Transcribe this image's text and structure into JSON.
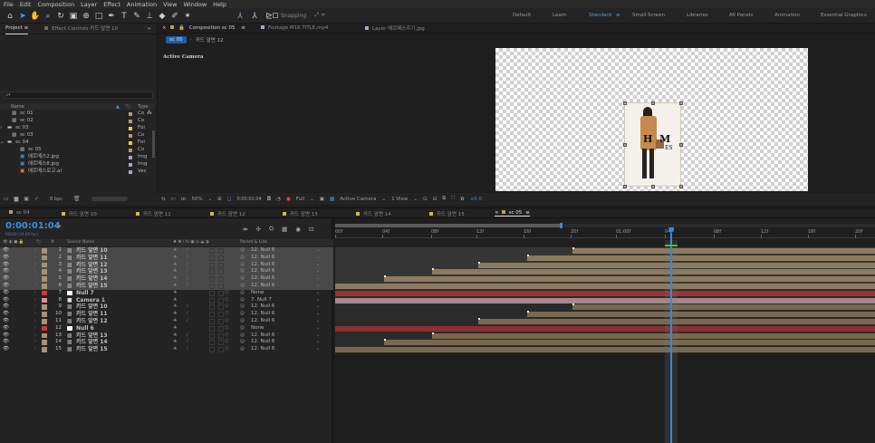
{
  "menu": [
    "File",
    "Edit",
    "Composition",
    "Layer",
    "Effect",
    "Animation",
    "View",
    "Window",
    "Help"
  ],
  "toolbar": {
    "snapping": "Snapping",
    "workspaces": [
      "Default",
      "Learn",
      "Standard",
      "Small Screen",
      "Libraries",
      "All Panels",
      "Animation",
      "Essential Graphics"
    ],
    "active_workspace": "Standard",
    "workspace_menu": "≡"
  },
  "project_panel": {
    "tabs": [
      "Project",
      "Effect Controls 카드 앞면 10"
    ],
    "menu": "≡",
    "expand": "»",
    "search_placeholder": "ρ▾",
    "col_name": "Name",
    "col_type": "Type",
    "items": [
      {
        "name": "sc 01",
        "type": "Co",
        "color": "#b59c6e",
        "kind": "comp"
      },
      {
        "name": "sc 02",
        "type": "Co",
        "color": "#b59c6e",
        "kind": "comp"
      },
      {
        "name": "sc 03",
        "type": "Fol",
        "color": "#e6cd45",
        "kind": "folder"
      },
      {
        "name": "sc 03",
        "type": "Co",
        "color": "#b59c6e",
        "kind": "comp"
      },
      {
        "name": "sc 04",
        "type": "Fol",
        "color": "#e6cd45",
        "kind": "folder"
      },
      {
        "name": "sc 05",
        "type": "Co",
        "color": "#b59c6e",
        "kind": "comp"
      },
      {
        "name": "에르메스2.jpg",
        "type": "Img",
        "color": "#a8a4ce",
        "kind": "img"
      },
      {
        "name": "에르메스8.jpg",
        "type": "Img",
        "color": "#a8a4ce",
        "kind": "img"
      },
      {
        "name": "에르메스로고.ai",
        "type": "Vec",
        "color": "#a8a4ce",
        "kind": "ai"
      }
    ],
    "footer": "8 bpc"
  },
  "comp_panel": {
    "tabs": [
      "Composition sc 05",
      "Footage M16 TITLE.mp4",
      "Layer 에르메스주기.jpg"
    ],
    "menu": "≡",
    "breadcrumb": [
      "sc 05",
      "카드 앞면 12"
    ],
    "view_label": "Active Camera",
    "logo_text": "H  M",
    "logo_sub": "ES"
  },
  "viewer_bar": {
    "zoom": "50%",
    "timecode": "0:00:01:04",
    "resolution": "Full",
    "camera": "Active Camera",
    "views": "1 View",
    "exposure": "+0.0"
  },
  "timeline": {
    "tabs": [
      "sc 04",
      "카드 앞면 10",
      "카드 앞면 11",
      "카드 앞면 12",
      "카드 앞면 13",
      "카드 앞면 14",
      "카드 앞면 15",
      "sc 05"
    ],
    "active_tab": "sc 05",
    "menu": "≡",
    "timecode": "0:00:01:04",
    "fps": "00028 (24.00 fps)",
    "search_placeholder": "ρ▾",
    "col_source": "Source Name",
    "col_parent": "Parent & Link",
    "switches_header": "♣ ✱ \\ fx ▣ ◎ ◒ ◑",
    "ruler": [
      "00f",
      "04f",
      "08f",
      "12f",
      "16f",
      "20f",
      "01:00f",
      "04f",
      "08f",
      "12f",
      "16f",
      "20f"
    ],
    "current_time_fraction": 0.623,
    "layers": [
      {
        "num": "1",
        "name": "카드 앞면 10",
        "label": "#a89274",
        "type": "comp",
        "parent": "12. Null 6",
        "sel": true,
        "start": 0.44,
        "end": 1.0,
        "color": "#8c7a5e"
      },
      {
        "num": "2",
        "name": "카드 앞면 11",
        "label": "#a89274",
        "type": "comp",
        "parent": "12. Null 6",
        "sel": true,
        "start": 0.355,
        "end": 1.0,
        "color": "#8c7a5e"
      },
      {
        "num": "3",
        "name": "카드 앞면 12",
        "label": "#a89274",
        "type": "comp",
        "parent": "12. Null 6",
        "sel": true,
        "start": 0.265,
        "end": 1.0,
        "color": "#8c7a5e"
      },
      {
        "num": "4",
        "name": "카드 앞면 13",
        "label": "#a89274",
        "type": "comp",
        "parent": "12. Null 6",
        "sel": true,
        "start": 0.18,
        "end": 1.0,
        "color": "#8c7a5e"
      },
      {
        "num": "5",
        "name": "카드 앞면 14",
        "label": "#a89274",
        "type": "comp",
        "parent": "12. Null 6",
        "sel": true,
        "start": 0.09,
        "end": 1.0,
        "color": "#8c7a5e"
      },
      {
        "num": "6",
        "name": "카드 앞면 15",
        "label": "#a89274",
        "type": "comp",
        "parent": "12. Null 6",
        "sel": true,
        "start": 0.0,
        "end": 1.0,
        "color": "#8c7a5e"
      },
      {
        "num": "7",
        "name": "Null 7",
        "label": "#c83a3a",
        "type": "null",
        "parent": "None",
        "sel": false,
        "start": 0.0,
        "end": 1.0,
        "color": "#9a3434"
      },
      {
        "num": "8",
        "name": "Camera 1",
        "label": "#d98f9a",
        "type": "camera",
        "parent": "7. Null 7",
        "sel": false,
        "start": 0.0,
        "end": 1.0,
        "color": "#a88890"
      },
      {
        "num": "9",
        "name": "카드 앞면 10",
        "label": "#a89274",
        "type": "comp",
        "parent": "12. Null 6",
        "sel": false,
        "start": 0.44,
        "end": 1.0,
        "color": "#77684f"
      },
      {
        "num": "10",
        "name": "카드 앞면 11",
        "label": "#a89274",
        "type": "comp",
        "parent": "12. Null 6",
        "sel": false,
        "start": 0.355,
        "end": 1.0,
        "color": "#77684f"
      },
      {
        "num": "11",
        "name": "카드 앞면 12",
        "label": "#a89274",
        "type": "comp",
        "parent": "12. Null 6",
        "sel": false,
        "start": 0.265,
        "end": 1.0,
        "color": "#77684f"
      },
      {
        "num": "12",
        "name": "Null 6",
        "label": "#c83a3a",
        "type": "null",
        "parent": "None",
        "sel": false,
        "start": 0.0,
        "end": 1.0,
        "color": "#8a3030"
      },
      {
        "num": "13",
        "name": "카드 앞면 13",
        "label": "#a89274",
        "type": "comp",
        "parent": "12. Null 6",
        "sel": false,
        "start": 0.18,
        "end": 1.0,
        "color": "#77684f"
      },
      {
        "num": "14",
        "name": "카드 앞면 14",
        "label": "#a89274",
        "type": "comp",
        "parent": "12. Null 6",
        "sel": false,
        "start": 0.09,
        "end": 1.0,
        "color": "#77684f"
      },
      {
        "num": "15",
        "name": "카드 앞면 15",
        "label": "#a89274",
        "type": "comp",
        "parent": "12. Null 6",
        "sel": false,
        "start": 0.0,
        "end": 1.0,
        "color": "#77684f"
      }
    ]
  },
  "colors": {
    "accent": "#2d8ceb",
    "timecode": "#3a8fe0"
  }
}
